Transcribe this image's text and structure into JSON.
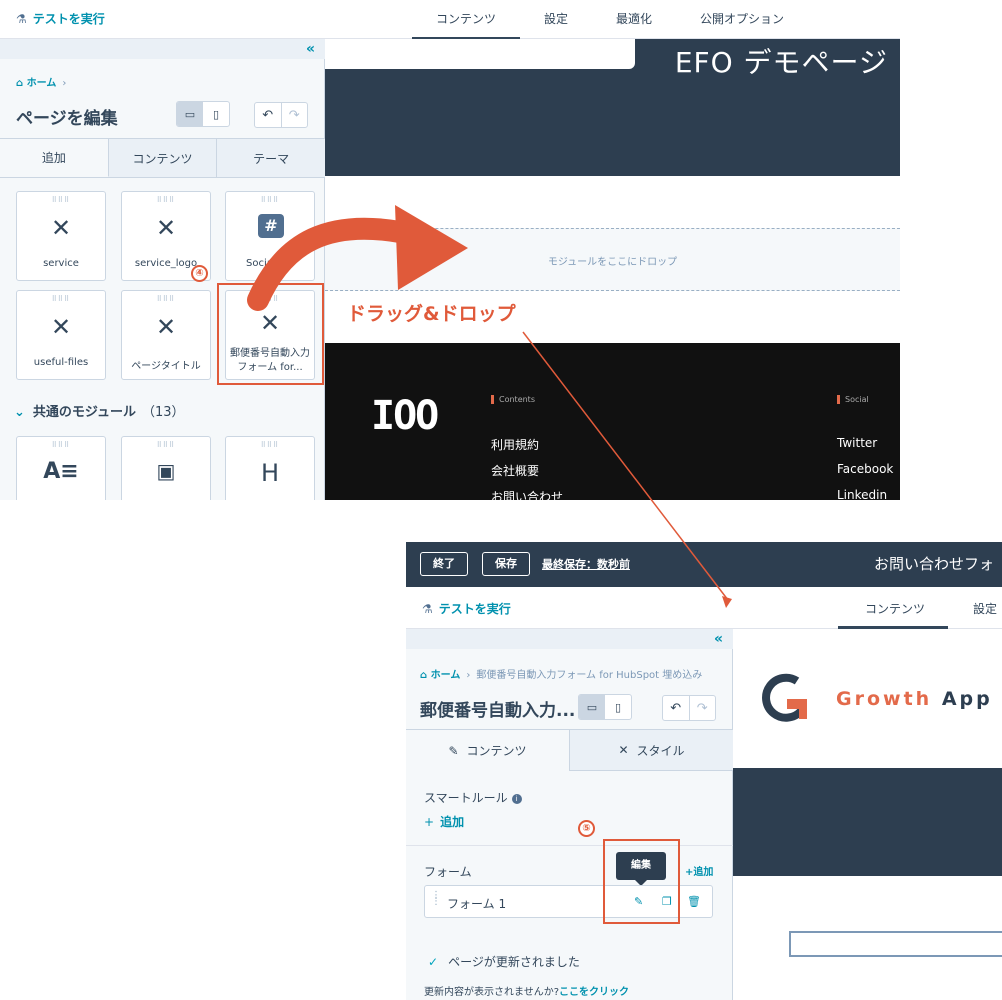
{
  "top": {
    "run_test": "テストを実行",
    "tabs": [
      "コンテンツ",
      "設定",
      "最適化",
      "公開オプション"
    ],
    "breadcrumb_home": "ホーム",
    "page_title": "ページを編集",
    "side_tabs": [
      "追加",
      "コンテンツ",
      "テーマ"
    ],
    "modules": [
      {
        "label": "service"
      },
      {
        "label": "service_logo"
      },
      {
        "label": "Social foll"
      },
      {
        "label": "useful-files"
      },
      {
        "label": "ページタイトル"
      },
      {
        "label": "郵便番号自動入力フォーム for..."
      }
    ],
    "common_modules_title": "共通のモジュール",
    "common_modules_count": "（13）",
    "hero_title": "EFO デモページ",
    "dropzone_text": "モジュールをここにドロップ",
    "footer": {
      "logo": "IOO",
      "contents_heading": "Contents",
      "social_heading": "Social",
      "contents_links": [
        "利用規約",
        "会社概要",
        "お問い合わせ"
      ],
      "social_links": [
        "Twitter",
        "Facebook",
        "Linkedin"
      ]
    }
  },
  "bottom": {
    "exit_label": "終了",
    "save_label": "保存",
    "last_saved": "最終保存：数秒前",
    "header_title": "お問い合わせフォ",
    "run_test": "テストを実行",
    "tabs": [
      "コンテンツ",
      "設定"
    ],
    "breadcrumb_home": "ホーム",
    "breadcrumb_sub": "郵便番号自動入力フォーム for HubSpot 埋め込み",
    "module_title": "郵便番号自動入力...",
    "side_tabs": [
      "コンテンツ",
      "スタイル"
    ],
    "smart_rules": "スマートルール",
    "add": "追加",
    "form_label": "フォーム",
    "form_add": "+追加",
    "tooltip": "編集",
    "form_item": "フォーム 1",
    "updated_msg": "ページが更新されました",
    "not_shown_prefix": "更新内容が表示されませんか?",
    "click_here": "ここをクリック",
    "brand_orange": "Growth",
    "brand_dark": "App"
  },
  "annotations": {
    "step4": "④",
    "step5": "⑤",
    "drag_drop": "ドラッグ&ドロップ"
  },
  "colors": {
    "accent": "#0091ae",
    "navy": "#2d3e50",
    "annotation": "#e05a3a"
  }
}
